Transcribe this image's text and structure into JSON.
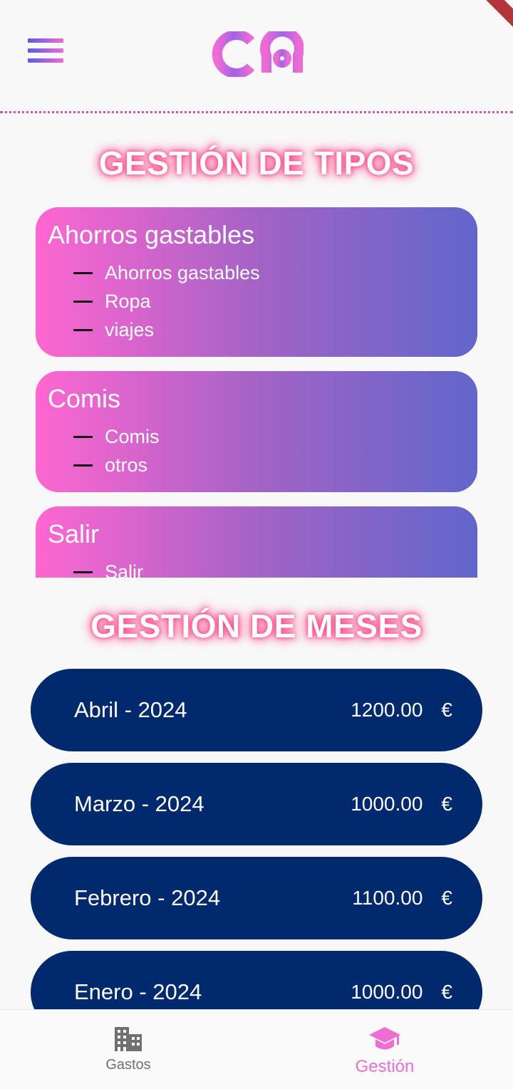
{
  "header": {
    "menu_icon": "hamburger-menu-icon",
    "logo_icon": "co-logo-icon"
  },
  "sections": {
    "types_title": "GESTIÓN DE TIPOS",
    "months_title": "GESTIÓN DE MESES"
  },
  "types": [
    {
      "title": "Ahorros gastables",
      "items": [
        "Ahorros gastables",
        "Ropa",
        "viajes"
      ]
    },
    {
      "title": "Comis",
      "items": [
        "Comis",
        "otros"
      ]
    },
    {
      "title": "Salir",
      "items": [
        "Salir"
      ]
    }
  ],
  "months": [
    {
      "name": "Abril - 2024",
      "amount": "1200.00",
      "currency": "€"
    },
    {
      "name": "Marzo - 2024",
      "amount": "1000.00",
      "currency": "€"
    },
    {
      "name": "Febrero - 2024",
      "amount": "1100.00",
      "currency": "€"
    },
    {
      "name": "Enero - 2024",
      "amount": "1000.00",
      "currency": "€"
    }
  ],
  "bottom_nav": {
    "items": [
      {
        "label": "Gastos",
        "icon": "building-icon"
      },
      {
        "label": "Gestión",
        "icon": "graduation-cap-icon",
        "active": true
      }
    ]
  },
  "colors": {
    "accent_pink": "#ee6ed3",
    "month_pill": "#00296e",
    "gradient_start": "#ff66d1",
    "gradient_end": "#6166cb"
  }
}
